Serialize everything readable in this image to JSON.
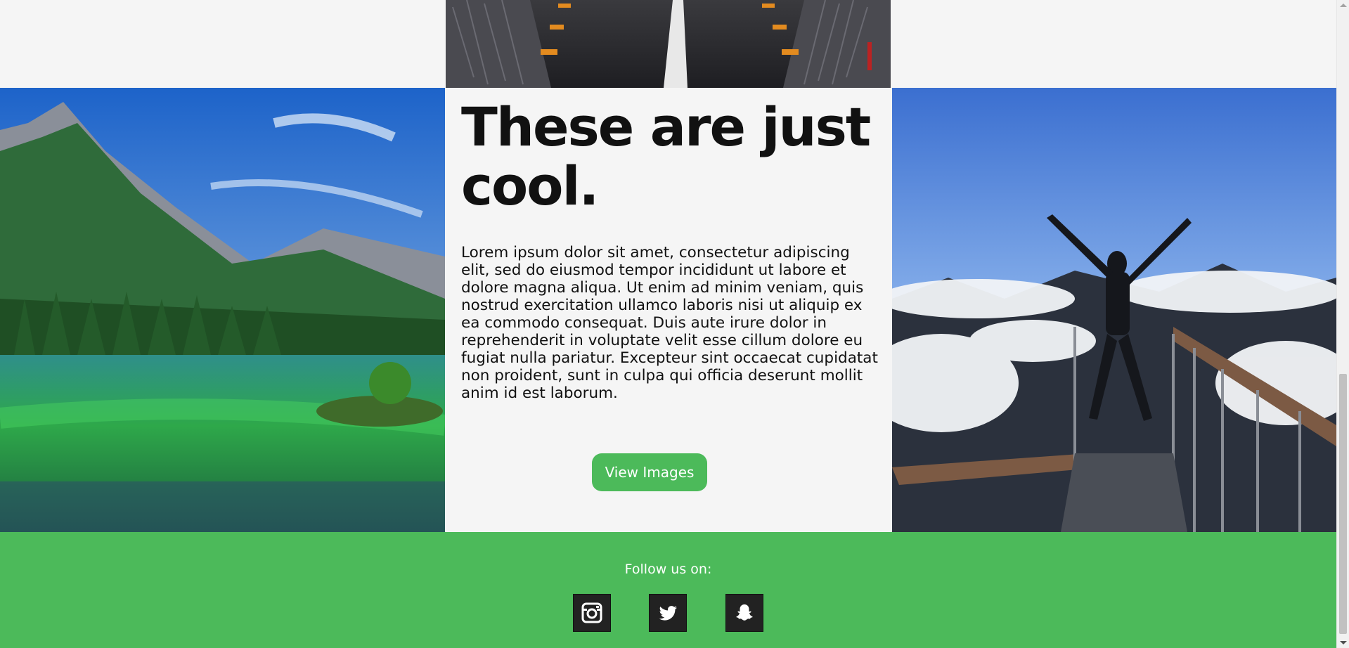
{
  "images": {
    "top": "boardwalk-road-photo",
    "left": "mountain-lake-photo",
    "right": "hiker-above-clouds-photo"
  },
  "feature": {
    "headline": "These are just cool.",
    "body": "Lorem ipsum dolor sit amet, consectetur adipiscing elit, sed do eiusmod tempor incididunt ut labore et dolore magna aliqua. Ut enim ad minim veniam, quis nostrud exercitation ullamco laboris nisi ut aliquip ex ea commodo consequat. Duis aute irure dolor in reprehenderit in voluptate velit esse cillum dolore eu fugiat nulla pariatur. Excepteur sint occaecat cupidatat non proident, sunt in culpa qui officia deserunt mollit anim id est laborum.",
    "button_label": "View Images"
  },
  "footer": {
    "follow_label": "Follow us on:",
    "social": [
      {
        "icon": "instagram-icon"
      },
      {
        "icon": "twitter-icon"
      },
      {
        "icon": "snapchat-icon"
      }
    ]
  },
  "colors": {
    "accent_green": "#4cba5a",
    "page_background": "#f5f5f5",
    "social_tile": "#222222"
  }
}
